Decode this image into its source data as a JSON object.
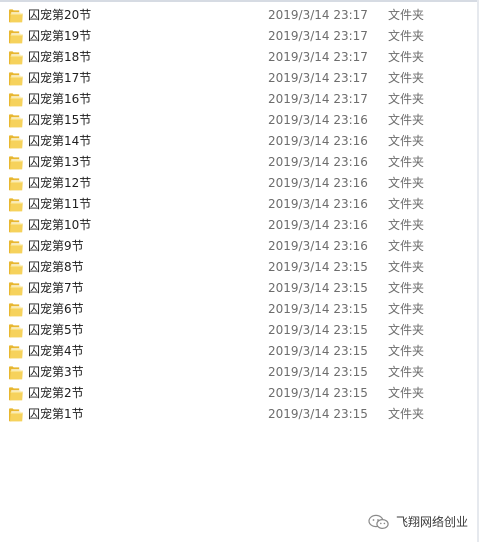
{
  "colors": {
    "folder_body": "#e8b730",
    "folder_front": "#f6d25c",
    "name_text": "#1e1e1e",
    "meta_text": "#6d6d6d"
  },
  "icons": {
    "folder": "folder-icon",
    "watermark": "wechat-icon"
  },
  "files": [
    {
      "name": "囚宠第20节",
      "date": "2019/3/14 23:17",
      "type": "文件夹"
    },
    {
      "name": "囚宠第19节",
      "date": "2019/3/14 23:17",
      "type": "文件夹"
    },
    {
      "name": "囚宠第18节",
      "date": "2019/3/14 23:17",
      "type": "文件夹"
    },
    {
      "name": "囚宠第17节",
      "date": "2019/3/14 23:17",
      "type": "文件夹"
    },
    {
      "name": "囚宠第16节",
      "date": "2019/3/14 23:17",
      "type": "文件夹"
    },
    {
      "name": "囚宠第15节",
      "date": "2019/3/14 23:16",
      "type": "文件夹"
    },
    {
      "name": "囚宠第14节",
      "date": "2019/3/14 23:16",
      "type": "文件夹"
    },
    {
      "name": "囚宠第13节",
      "date": "2019/3/14 23:16",
      "type": "文件夹"
    },
    {
      "name": "囚宠第12节",
      "date": "2019/3/14 23:16",
      "type": "文件夹"
    },
    {
      "name": "囚宠第11节",
      "date": "2019/3/14 23:16",
      "type": "文件夹"
    },
    {
      "name": "囚宠第10节",
      "date": "2019/3/14 23:16",
      "type": "文件夹"
    },
    {
      "name": "囚宠第9节",
      "date": "2019/3/14 23:16",
      "type": "文件夹"
    },
    {
      "name": "囚宠第8节",
      "date": "2019/3/14 23:15",
      "type": "文件夹"
    },
    {
      "name": "囚宠第7节",
      "date": "2019/3/14 23:15",
      "type": "文件夹"
    },
    {
      "name": "囚宠第6节",
      "date": "2019/3/14 23:15",
      "type": "文件夹"
    },
    {
      "name": "囚宠第5节",
      "date": "2019/3/14 23:15",
      "type": "文件夹"
    },
    {
      "name": "囚宠第4节",
      "date": "2019/3/14 23:15",
      "type": "文件夹"
    },
    {
      "name": "囚宠第3节",
      "date": "2019/3/14 23:15",
      "type": "文件夹"
    },
    {
      "name": "囚宠第2节",
      "date": "2019/3/14 23:15",
      "type": "文件夹"
    },
    {
      "name": "囚宠第1节",
      "date": "2019/3/14 23:15",
      "type": "文件夹"
    }
  ],
  "watermark": {
    "text": "飞翔网络创业"
  }
}
